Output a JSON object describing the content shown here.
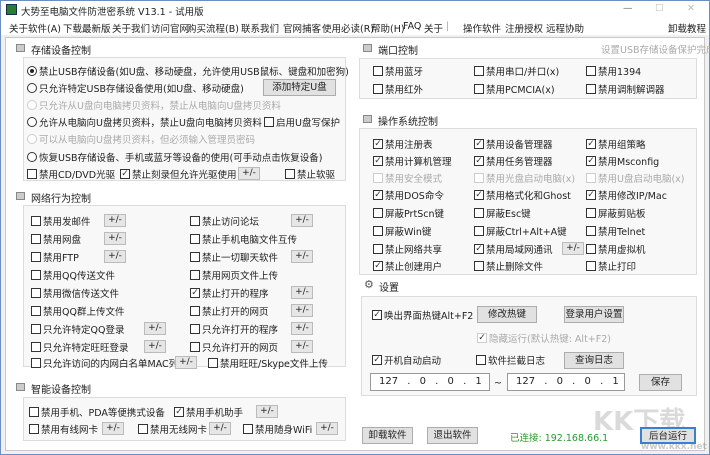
{
  "window": {
    "title": "大势至电脑文件防泄密系统 V13.1 - 试用版",
    "minimize": "—",
    "maximize": "☐",
    "close": "✕"
  },
  "menu": [
    "关于软件(A)",
    "下载最新版",
    "关于我们",
    "访问官网",
    "购买流程(B)",
    "联系我们",
    "官网捕客",
    "使用必读(R)",
    "帮助(H)",
    "FAQ",
    "关于",
    "|",
    "操作软件",
    "注册授权",
    "远程协助"
  ],
  "menu_right": "卸载教程",
  "storage": {
    "title": "存储设备控制",
    "options": [
      {
        "label": "禁止USB存储设备(如U盘、移动硬盘，允许使用USB鼠标、键盘和加密狗)",
        "type": "radio",
        "checked": true
      },
      {
        "label": "只允许特定USB存储设备使用(如U盘、移动硬盘)",
        "type": "radio"
      },
      {
        "label": "只允许从U盘向电脑拷贝资料，禁止从电脑向U盘拷贝资料",
        "type": "radio",
        "disabled": true
      },
      {
        "label": "允许从电脑向U盘拷贝资料，禁止U盘向电脑拷贝资料",
        "type": "radio"
      },
      {
        "label": "可以从电脑向U盘拷贝资料，但必须输入管理员密码",
        "type": "radio",
        "disabled": true
      },
      {
        "label": "恢复USB存储设备、手机或蓝牙等设备的使用(可手动点击恢复设备)",
        "type": "radio"
      }
    ],
    "add_udisk": "添加特定U盘",
    "write_protect": "启用U盘写保护",
    "cd_dvd": "禁用CD/DVD光驱",
    "burn": "禁止刻录但允许光驱使用",
    "floppy": "禁止软驱",
    "pm": "+/-"
  },
  "network": {
    "title": "网络行为控制",
    "left": [
      {
        "label": "禁用发邮件",
        "pm": true
      },
      {
        "label": "禁用网盘",
        "pm": true
      },
      {
        "label": "禁用FTP",
        "pm": true
      },
      {
        "label": "禁用QQ传送文件"
      },
      {
        "label": "禁用微信传送文件"
      },
      {
        "label": "禁用QQ群上传文件"
      },
      {
        "label": "只允许特定QQ登录",
        "pm": true
      },
      {
        "label": "只允许特定旺旺登录",
        "pm": true
      }
    ],
    "right": [
      {
        "label": "禁止访问论坛",
        "pm": true
      },
      {
        "label": "禁止手机电脑文件互传"
      },
      {
        "label": "禁止一切聊天软件",
        "pm": true
      },
      {
        "label": "禁用网页文件上传"
      },
      {
        "label": "禁止打开的程序",
        "pm": true,
        "checked": true
      },
      {
        "label": "禁止打开的网页",
        "pm": true
      },
      {
        "label": "只允许打开的程序",
        "pm": true
      },
      {
        "label": "只允许打开的网页",
        "pm": true
      }
    ],
    "mac": "只允许访问的内网白名单MAC列表",
    "wangwang": "禁用旺旺/Skype文件上传"
  },
  "smart": {
    "title": "智能设备控制",
    "pda": "禁用手机、PDA等便携式设备",
    "assistant": "禁用手机助手",
    "wired": "禁用有线网卡",
    "wireless": "禁用无线网卡",
    "wifi": "禁用随身WiFi"
  },
  "port": {
    "title": "端口控制",
    "status": "设置USB存储设备保护完成",
    "items": [
      {
        "label": "禁用蓝牙"
      },
      {
        "label": "禁用串口/并口(x)"
      },
      {
        "label": "禁用1394"
      },
      {
        "label": "禁用红外"
      },
      {
        "label": "禁用PCMCIA(x)"
      },
      {
        "label": "禁用调制解调器"
      }
    ]
  },
  "os": {
    "title": "操作系统控制",
    "items": [
      {
        "label": "禁用注册表",
        "checked": true
      },
      {
        "label": "禁用设备管理器",
        "checked": true
      },
      {
        "label": "禁用组策略",
        "checked": true
      },
      {
        "label": "禁用计算机管理",
        "checked": true
      },
      {
        "label": "禁用任务管理器",
        "checked": true
      },
      {
        "label": "禁用Msconfig",
        "checked": true
      },
      {
        "label": "禁用安全模式",
        "disabled": true
      },
      {
        "label": "禁用光盘启动电脑(x)",
        "disabled": true
      },
      {
        "label": "禁用U盘启动电脑(x)",
        "disabled": true
      },
      {
        "label": "禁用DOS命令",
        "checked": true
      },
      {
        "label": "禁用格式化和Ghost",
        "checked": true
      },
      {
        "label": "禁用修改IP/Mac",
        "checked": true
      },
      {
        "label": "屏蔽PrtScn键"
      },
      {
        "label": "屏蔽Esc键"
      },
      {
        "label": "屏蔽剪贴板"
      },
      {
        "label": "屏蔽Win键"
      },
      {
        "label": "屏蔽Ctrl+Alt+A键"
      },
      {
        "label": "禁用Telnet"
      },
      {
        "label": "禁止网络共享"
      },
      {
        "label": "禁用局域网通讯",
        "checked": true,
        "pm": true
      },
      {
        "label": "禁用虚拟机"
      },
      {
        "label": "禁止创建用户",
        "checked": true
      },
      {
        "label": "禁止删除文件"
      },
      {
        "label": "禁止打印"
      }
    ]
  },
  "settings": {
    "title": "设置",
    "hotkey": "唤出界面热键Alt+F2",
    "modify_hotkey": "修改热键",
    "login_settings": "登录用户设置",
    "hidden_run": "隐藏运行(默认热键: Alt+F2)",
    "autostart": "开机自动启动",
    "intercept_log": "软件拦截日志",
    "query_log": "查询日志",
    "ip_from": "127 . 0 . 0 . 1",
    "tilde": "~",
    "ip_to": "127 . 0 . 0 . 1",
    "save": "保存"
  },
  "footer": {
    "uninstall": "卸载软件",
    "exit": "退出软件",
    "connected": "已连接: 192.168.66.1",
    "background": "后台运行",
    "connected_color": "#2a9a2a"
  },
  "watermark": {
    "logo": "KK下载",
    "url": "www.kkx.net"
  }
}
